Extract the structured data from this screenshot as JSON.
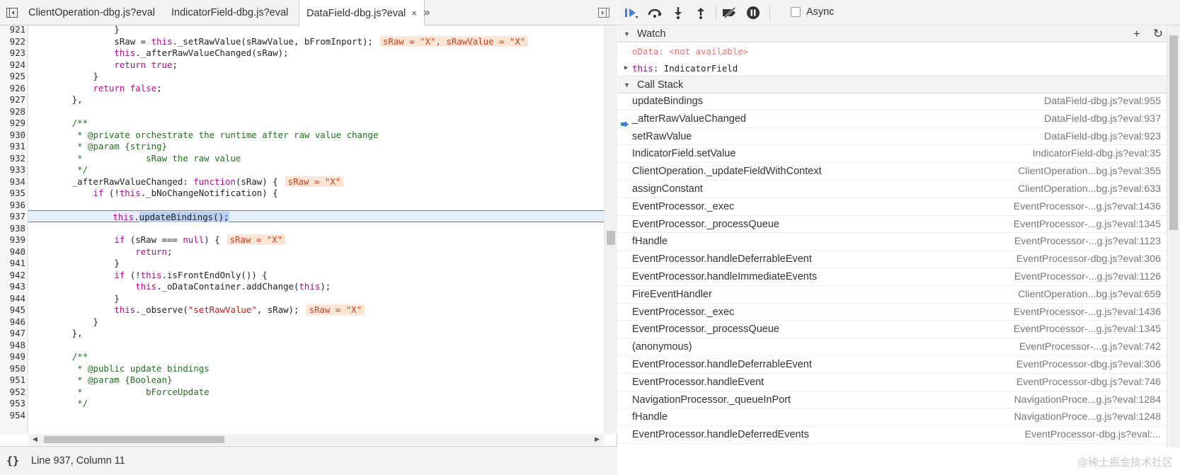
{
  "tabs": [
    {
      "label": "ClientOperation-dbg.js?eval"
    },
    {
      "label": "IndicatorField-dbg.js?eval"
    },
    {
      "label": "DataField-dbg.js?eval",
      "close": "×"
    }
  ],
  "tab_overflow": "»",
  "code_lines": [
    {
      "n": "921",
      "html": "                <span>}</span>"
    },
    {
      "n": "922",
      "html": "                sRaw = <span class=\"kw\">this</span>._setRawValue(sRawValue, bFromInport);<span class=\"ann\">sRaw = \"X\", sRawValue = \"X\"</span>"
    },
    {
      "n": "923",
      "html": "                <span class=\"kw\">this</span>._afterRawValueChanged(sRaw);"
    },
    {
      "n": "924",
      "html": "                <span class=\"kw\">return true</span>;"
    },
    {
      "n": "925",
      "html": "            }"
    },
    {
      "n": "926",
      "html": "            <span class=\"kw\">return false</span>;"
    },
    {
      "n": "927",
      "html": "        },"
    },
    {
      "n": "928",
      "html": ""
    },
    {
      "n": "929",
      "html": "        <span class=\"cm\">/**</span>"
    },
    {
      "n": "930",
      "html": "<span class=\"cm\">         * @private orchestrate the runtime after raw value change</span>"
    },
    {
      "n": "931",
      "html": "<span class=\"cm\">         * @param {string}</span>"
    },
    {
      "n": "932",
      "html": "<span class=\"cm\">         *            sRaw the raw value</span>"
    },
    {
      "n": "933",
      "html": "<span class=\"cm\">         */</span>"
    },
    {
      "n": "934",
      "html": "        _afterRawValueChanged: <span class=\"kw\">function</span>(sRaw) {<span class=\"ann\">sRaw = \"X\"</span>"
    },
    {
      "n": "935",
      "html": "            <span class=\"kw\">if</span> (!<span class=\"kw\">this</span>._bNoChangeNotification) {"
    },
    {
      "n": "936",
      "html": ""
    },
    {
      "n": "937",
      "html": "                <span class=\"kw\">this</span>.<span class=\"sel\">updateBindings();</span>",
      "exec": true
    },
    {
      "n": "938",
      "html": ""
    },
    {
      "n": "939",
      "html": "                <span class=\"kw\">if</span> (sRaw === <span class=\"kw\">null</span>) {<span class=\"ann\">sRaw = \"X\"</span>"
    },
    {
      "n": "940",
      "html": "                    <span class=\"kw\">return</span>;"
    },
    {
      "n": "941",
      "html": "                }"
    },
    {
      "n": "942",
      "html": "                <span class=\"kw\">if</span> (!<span class=\"kw\">this</span>.isFrontEndOnly()) {"
    },
    {
      "n": "943",
      "html": "                    <span class=\"kw\">this</span>._oDataContainer.addChange(<span class=\"kw\">this</span>);"
    },
    {
      "n": "944",
      "html": "                }"
    },
    {
      "n": "945",
      "html": "                <span class=\"kw\">this</span>._observe(<span class=\"st\">\"setRawValue\"</span>, sRaw);<span class=\"ann\">sRaw = \"X\"</span>"
    },
    {
      "n": "946",
      "html": "            }"
    },
    {
      "n": "947",
      "html": "        },"
    },
    {
      "n": "948",
      "html": ""
    },
    {
      "n": "949",
      "html": "        <span class=\"cm\">/**</span>"
    },
    {
      "n": "950",
      "html": "<span class=\"cm\">         * @public update bindings</span>"
    },
    {
      "n": "951",
      "html": "<span class=\"cm\">         * @param {Boolean}</span>"
    },
    {
      "n": "952",
      "html": "<span class=\"cm\">         *            bForceUpdate</span>"
    },
    {
      "n": "953",
      "html": "<span class=\"cm\">         */</span>"
    },
    {
      "n": "954",
      "html": ""
    }
  ],
  "status": {
    "braces": "{}",
    "position": "Line 937, Column 11"
  },
  "debugger": {
    "async_label": "Async"
  },
  "watch": {
    "title": "Watch",
    "add": "+",
    "refresh": "↻",
    "items": [
      {
        "name": "oData",
        "value": "<not available>"
      },
      {
        "name": "this",
        "value": "IndicatorField"
      }
    ]
  },
  "callstack": {
    "title": "Call Stack",
    "frames": [
      {
        "fn": "updateBindings",
        "loc": "DataField-dbg.js?eval:955"
      },
      {
        "fn": "_afterRawValueChanged",
        "loc": "DataField-dbg.js?eval:937",
        "current": true
      },
      {
        "fn": "setRawValue",
        "loc": "DataField-dbg.js?eval:923"
      },
      {
        "fn": "IndicatorField.setValue",
        "loc": "IndicatorField-dbg.js?eval:35"
      },
      {
        "fn": "ClientOperation._updateFieldWithContext",
        "loc": "ClientOperation...bg.js?eval:355"
      },
      {
        "fn": "assignConstant",
        "loc": "ClientOperation...bg.js?eval:633"
      },
      {
        "fn": "EventProcessor._exec",
        "loc": "EventProcessor-...g.js?eval:1436"
      },
      {
        "fn": "EventProcessor._processQueue",
        "loc": "EventProcessor-...g.js?eval:1345"
      },
      {
        "fn": "fHandle",
        "loc": "EventProcessor-...g.js?eval:1123"
      },
      {
        "fn": "EventProcessor.handleDeferrableEvent",
        "loc": "EventProcessor-dbg.js?eval:306"
      },
      {
        "fn": "EventProcessor.handleImmediateEvents",
        "loc": "EventProcessor-...g.js?eval:1126"
      },
      {
        "fn": "FireEventHandler",
        "loc": "ClientOperation...bg.js?eval:659"
      },
      {
        "fn": "EventProcessor._exec",
        "loc": "EventProcessor-...g.js?eval:1436"
      },
      {
        "fn": "EventProcessor._processQueue",
        "loc": "EventProcessor-...g.js?eval:1345"
      },
      {
        "fn": "(anonymous)",
        "loc": "EventProcessor-...g.js?eval:742"
      },
      {
        "fn": "EventProcessor.handleDeferrableEvent",
        "loc": "EventProcessor-dbg.js?eval:306"
      },
      {
        "fn": "EventProcessor.handleEvent",
        "loc": "EventProcessor-dbg.js?eval:746"
      },
      {
        "fn": "NavigationProcessor._queueInPort",
        "loc": "NavigationProce...g.js?eval:1284"
      },
      {
        "fn": "fHandle",
        "loc": "NavigationProce...g.js?eval:1248"
      },
      {
        "fn": "EventProcessor.handleDeferredEvents",
        "loc": "EventProcessor-dbg.js?eval:..."
      }
    ]
  },
  "watermark": "@稀土掘金技术社区",
  "colors": {
    "exec_line_bg": "#e6eefb",
    "exec_line_border": "#4a7ed8",
    "keyword": "#aa0d91",
    "comment": "#236e25",
    "inline_value_bg": "#fbe6d4",
    "current_frame_arrow": "#3f7ee8"
  }
}
